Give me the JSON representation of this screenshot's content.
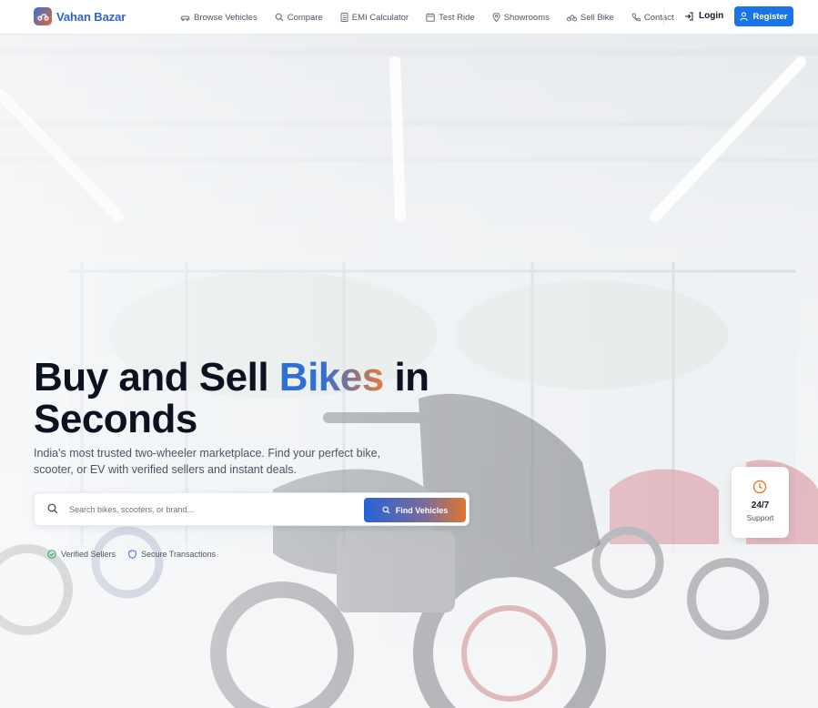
{
  "brand": {
    "name": "Vahan Bazar",
    "logo_icon": "scooter-icon"
  },
  "nav": {
    "items": [
      {
        "label": "Browse Vehicles",
        "icon": "car-icon"
      },
      {
        "label": "Compare",
        "icon": "search-icon"
      },
      {
        "label": "EMI Calculator",
        "icon": "calculator-icon"
      },
      {
        "label": "Test Ride",
        "icon": "calendar-icon"
      },
      {
        "label": "Showrooms",
        "icon": "map-pin-icon"
      },
      {
        "label": "Sell Bike",
        "icon": "bike-icon"
      },
      {
        "label": "Contact",
        "icon": "phone-icon"
      }
    ],
    "login_label": "Login",
    "register_label": "Register"
  },
  "hero": {
    "headline_part1": "Buy and Sell ",
    "headline_accent": "Bikes",
    "headline_part2": " in Seconds",
    "subtitle": "India's most trusted two-wheeler marketplace. Find your perfect bike, scooter, or EV with verified sellers and instant deals.",
    "search": {
      "placeholder": "Search bikes, scooters, or brand...",
      "value": "",
      "button_label": "Find Vehicles"
    },
    "badges": [
      {
        "label": "Verified Sellers",
        "icon": "check-circle-icon",
        "color": "#22a35a"
      },
      {
        "label": "Secure Transactions",
        "icon": "shield-icon",
        "color": "#3b6fd8"
      }
    ]
  },
  "support_card": {
    "value": "24/7",
    "label": "Support",
    "icon": "clock-icon",
    "color": "#e07a2f"
  },
  "colors": {
    "primary": "#1a73e8",
    "accent_orange": "#e07a2f",
    "headline": "#0b1220"
  }
}
